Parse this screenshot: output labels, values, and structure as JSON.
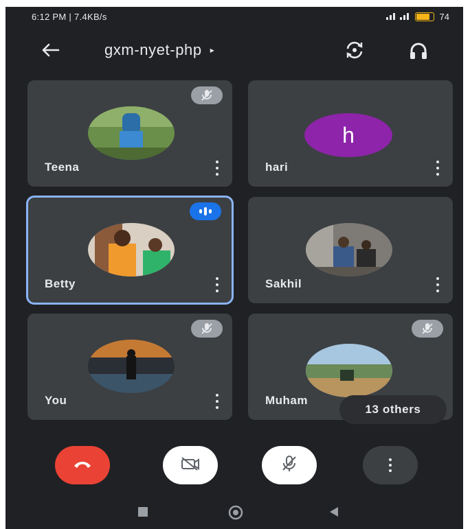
{
  "status_bar": {
    "left_text": "6:12 PM | 7.4KB/s",
    "battery_percent": "74",
    "battery_level": 0.74
  },
  "header": {
    "meeting_code": "gxm-nyet-php",
    "caret": "▸",
    "icons": [
      "back-arrow-icon",
      "switch-camera-icon",
      "headphones-icon"
    ]
  },
  "participants": [
    {
      "name": "Teena",
      "avatar": "photo",
      "status": "muted"
    },
    {
      "name": "hari",
      "avatar_letter": "h",
      "avatar_color": "#8e24aa",
      "status": "none"
    },
    {
      "name": "Betty",
      "avatar": "photo",
      "status": "speaking"
    },
    {
      "name": "Sakhil",
      "avatar": "photo",
      "status": "none"
    },
    {
      "name": "You",
      "avatar": "photo",
      "status": "muted"
    },
    {
      "name": "Muham",
      "avatar": "photo",
      "status": "muted"
    }
  ],
  "others_chip": {
    "label": "13 others"
  },
  "controls": {
    "icons": [
      "end-call-icon",
      "camera-off-icon",
      "mic-off-icon",
      "more-options-icon"
    ],
    "colors": {
      "end_call": "#ea4335",
      "toggle": "#ffffff",
      "more": "#3c4043"
    }
  },
  "colors": {
    "background": "#202124",
    "tile": "#3c4043",
    "active_outline": "#8ab4f8",
    "speaking_badge": "#1a73e8"
  }
}
